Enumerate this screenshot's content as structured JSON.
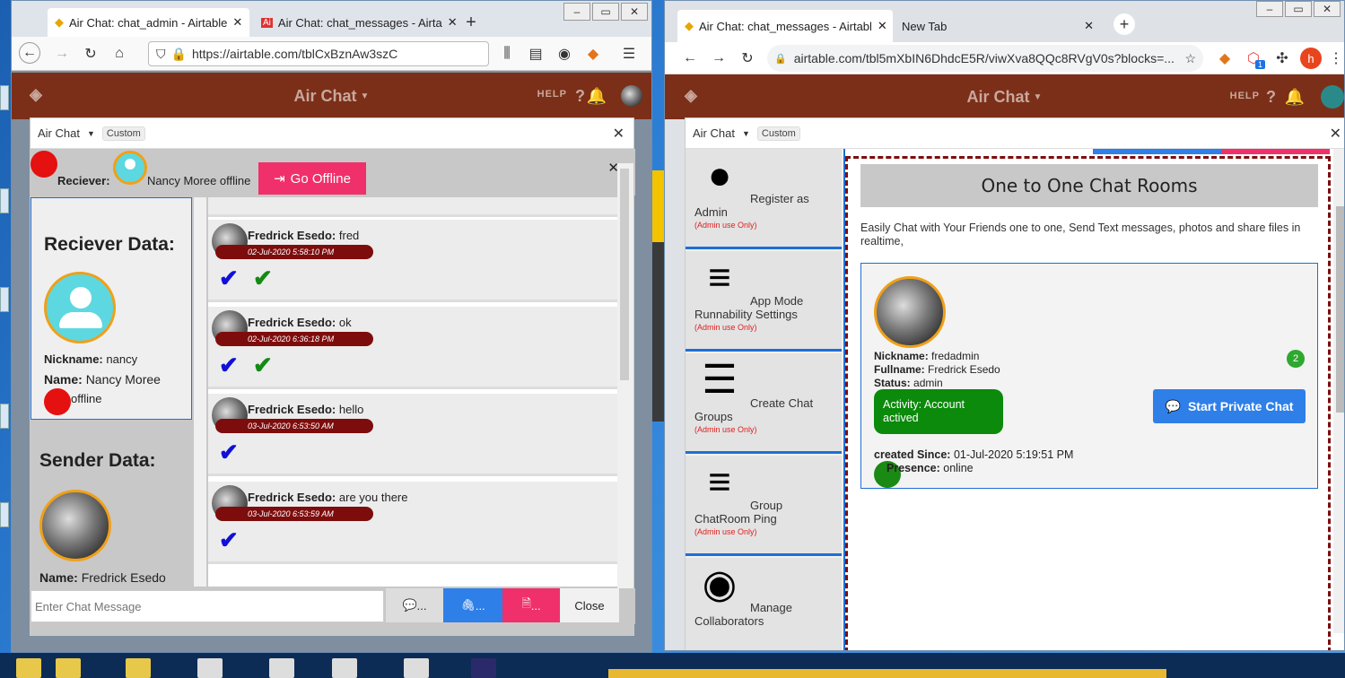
{
  "left_window": {
    "tabs": [
      {
        "label": "Air Chat: chat_admin - Airtable"
      },
      {
        "label": "Air Chat: chat_messages - Airta"
      }
    ],
    "url": "https://airtable.com/tblCxBznAw3szC",
    "app_title": "Air Chat",
    "help_label": "HELP",
    "block": {
      "name": "Air Chat",
      "badge": "Custom",
      "receiver_label": "Reciever",
      "receiver_status": "Nancy Moree offline",
      "go_offline_label": "Go Offline",
      "receiver_data_heading": "Reciever Data:",
      "nickname_label": "Nickname:",
      "nickname_value": "nancy",
      "name_label": "Name:",
      "name_value": "Nancy Moree",
      "presence_value": "offline",
      "sender_data_heading": "Sender Data:",
      "sender_name_label": "Name:",
      "sender_name_value": "Fredrick Esedo",
      "messages": [
        {
          "sender": "Fredrick Esedo:",
          "text": "fred",
          "time": "02-Jul-2020 5:58:10 PM",
          "double_check": true
        },
        {
          "sender": "Fredrick Esedo:",
          "text": "ok",
          "time": "02-Jul-2020 6:36:18 PM",
          "double_check": true
        },
        {
          "sender": "Fredrick Esedo:",
          "text": "hello",
          "time": "03-Jul-2020 6:53:50 AM",
          "double_check": false
        },
        {
          "sender": "Fredrick Esedo:",
          "text": "are you there",
          "time": "03-Jul-2020 6:53:59 AM",
          "double_check": false
        }
      ],
      "input_placeholder": "Enter Chat Message",
      "send_text_label": "...",
      "attach_label": "...",
      "file_label": "...",
      "close_label": "Close"
    }
  },
  "right_window": {
    "tabs": [
      {
        "label": "Air Chat: chat_messages - Airtabl"
      },
      {
        "label": "New Tab"
      }
    ],
    "url": "airtable.com/tbl5mXbIN6DhdcE5R/viwXva8QQc8RVgV0s?blocks=...",
    "profile_letter": "h",
    "ext_badge": "1",
    "app_title": "Air Chat",
    "help_label": "HELP",
    "block": {
      "name": "Air Chat",
      "badge": "Custom",
      "sidebar": [
        {
          "line1": "Register as",
          "line2": "Admin",
          "note": "(Admin use Only)"
        },
        {
          "line1": "App Mode",
          "line2": "Runnability Settings",
          "note": "(Admin use Only)"
        },
        {
          "line1": "Create Chat",
          "line2": "Groups",
          "note": "(Admin use Only)"
        },
        {
          "line1": "Group",
          "line2": "ChatRoom Ping",
          "note": "(Admin use Only)"
        },
        {
          "line1": "Manage",
          "line2": "Collaborators",
          "note": ""
        }
      ],
      "heading": "One to One Chat Rooms",
      "description": "Easily Chat with Your Friends one to one, Send Text messages, photos and share files in realtime,",
      "card": {
        "nickname_label": "Nickname:",
        "nickname_value": "fredadmin",
        "fullname_label": "Fullname:",
        "fullname_value": "Fredrick Esedo",
        "status_label": "Status:",
        "status_value": "admin",
        "activity": "Activity: Account actived",
        "count": "2",
        "start_chat_label": "Start Private Chat",
        "created_label": "created Since:",
        "created_value": "01-Jul-2020 5:19:51 PM",
        "presence_label": "Presence:",
        "presence_value": "online"
      }
    }
  },
  "colors": {
    "airtable_header": "#7b2f18",
    "go_offline": "#f0306a",
    "start_chat": "#2f7fe8",
    "online": "#1a8a14",
    "offline": "#e51010",
    "time_pill": "#7d0d0d"
  }
}
